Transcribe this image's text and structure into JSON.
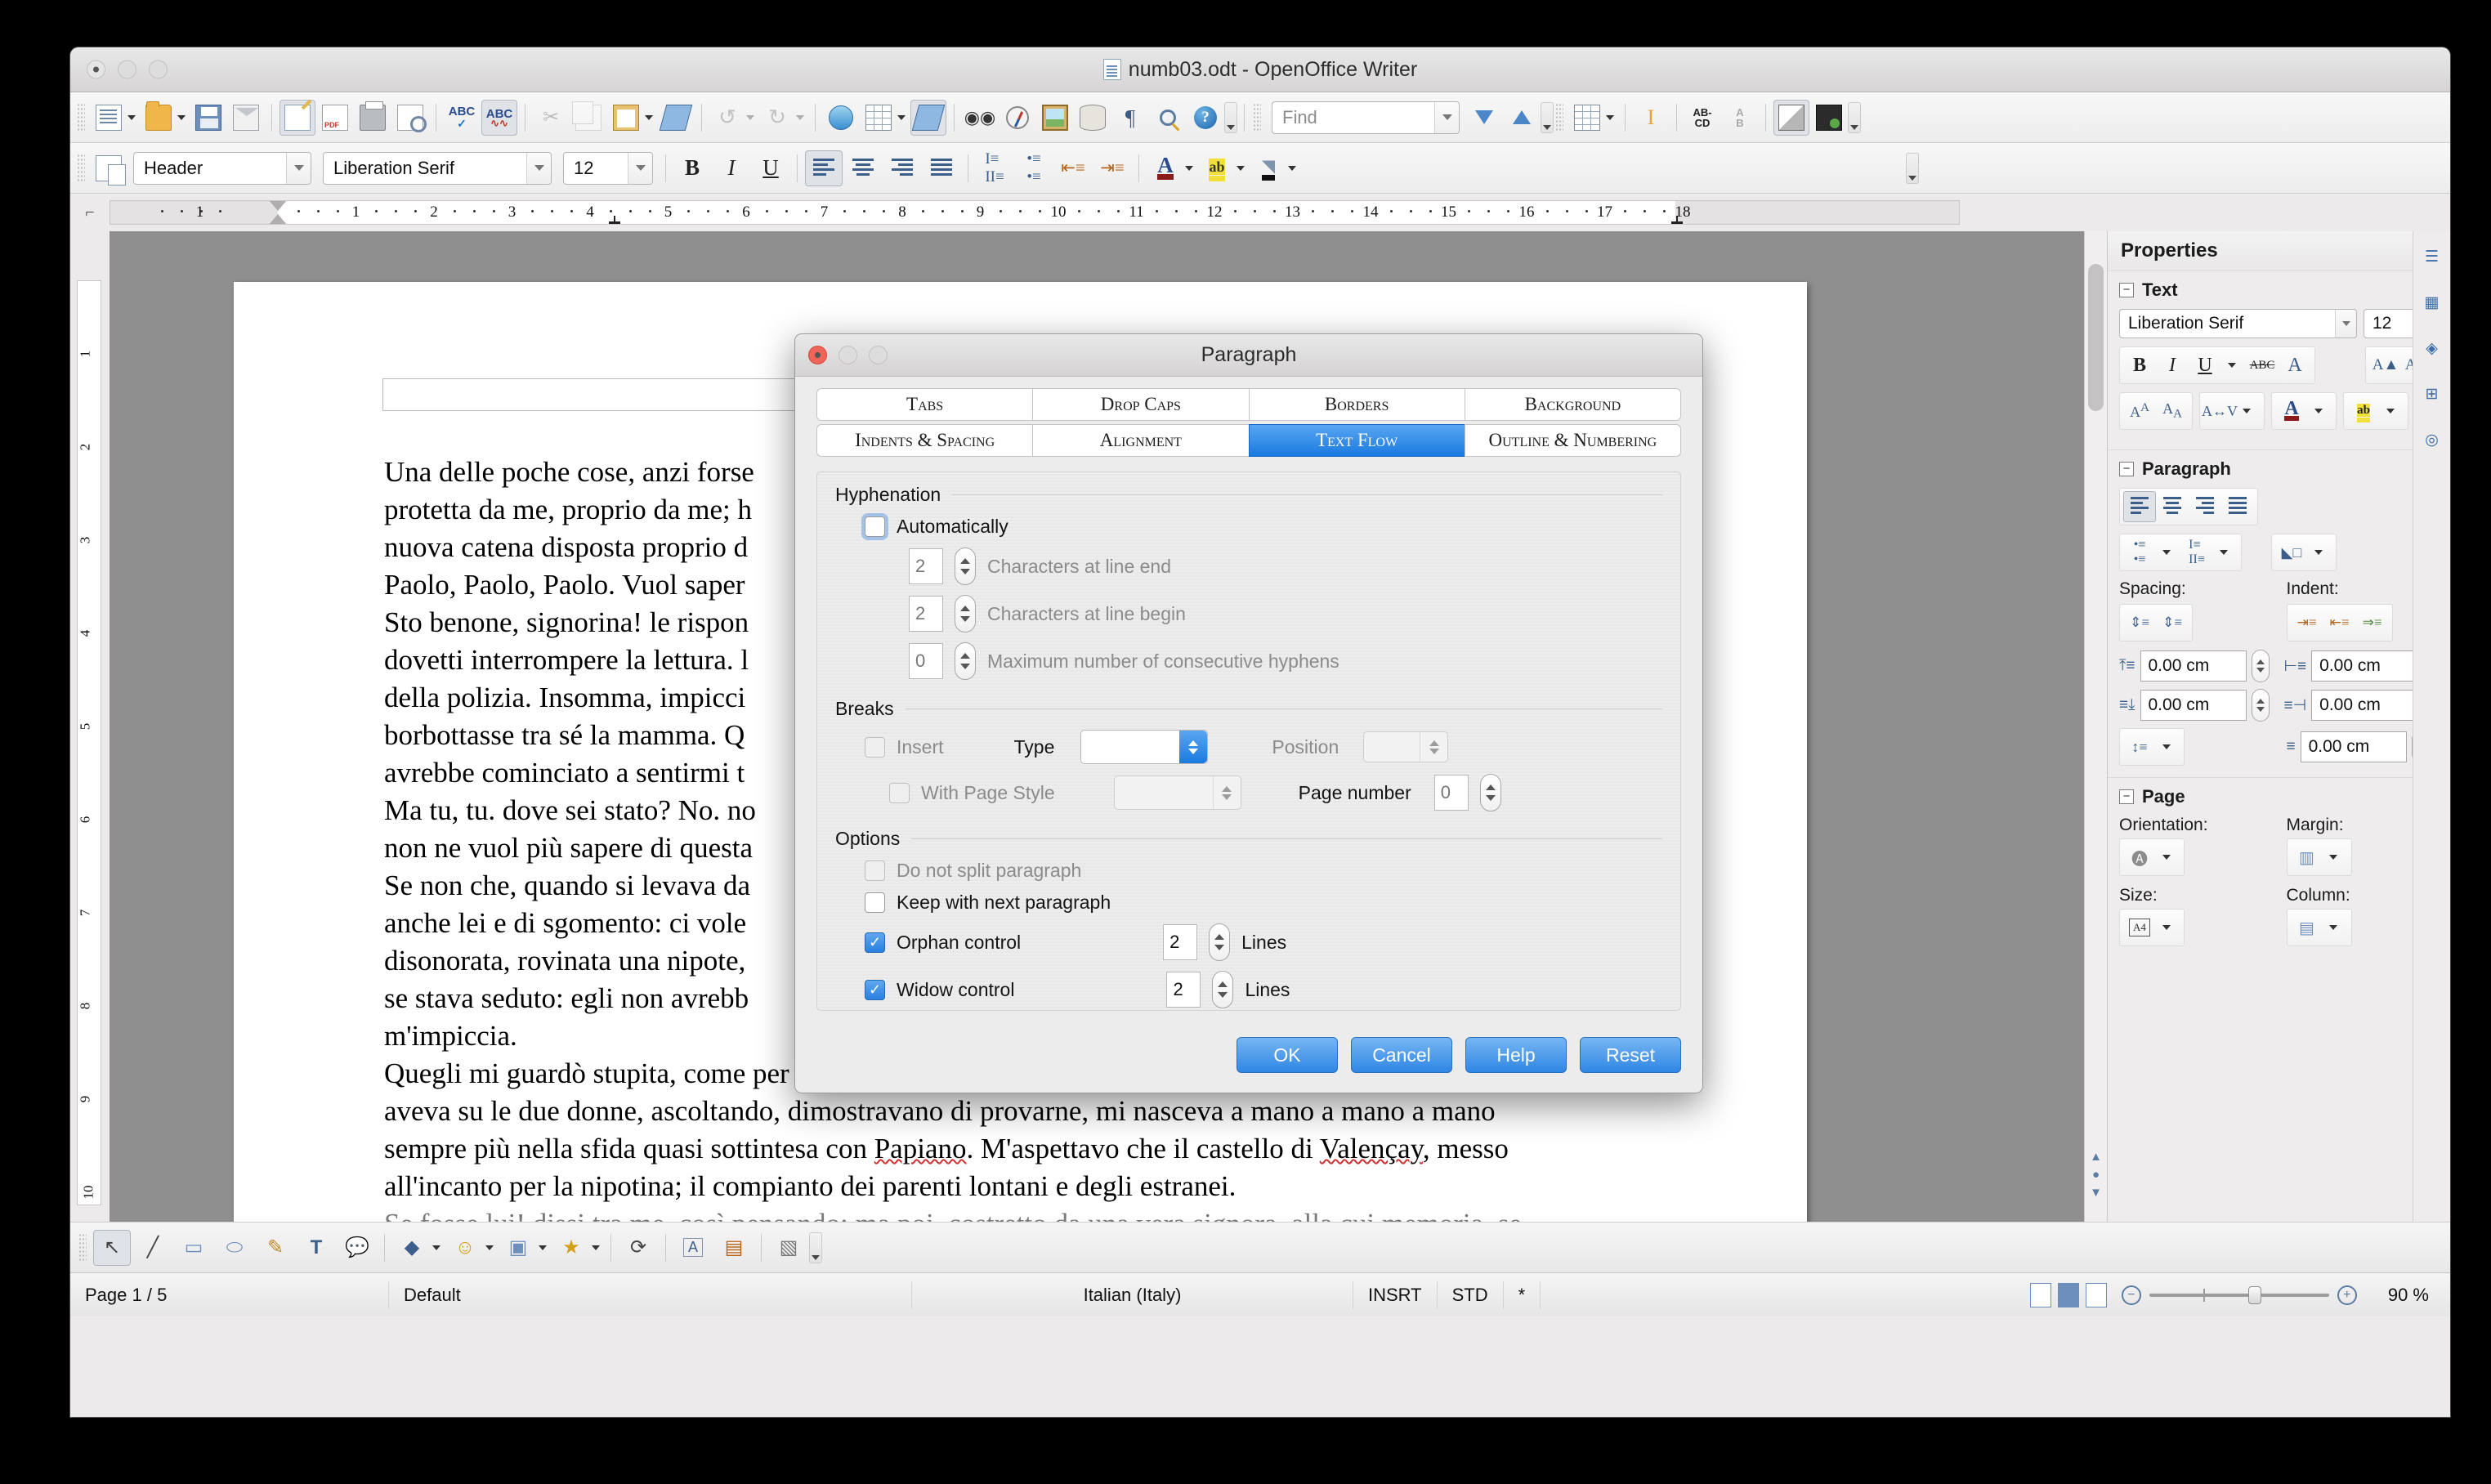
{
  "window": {
    "title": "numb03.odt - OpenOffice Writer"
  },
  "toolbar_standard": [
    {
      "name": "new-document",
      "icon": "new-doc-icon",
      "dropdown": true
    },
    {
      "name": "open-document",
      "icon": "open-folder-icon",
      "dropdown": true
    },
    {
      "name": "save-document",
      "icon": "save-disk-icon"
    },
    {
      "name": "email-document",
      "icon": "email-icon"
    },
    {
      "name": "edit-file",
      "icon": "edit-file-icon",
      "active": true
    },
    {
      "name": "export-pdf",
      "icon": "pdf-icon"
    },
    {
      "name": "print-document",
      "icon": "printer-icon"
    },
    {
      "name": "page-preview",
      "icon": "page-preview-icon"
    },
    {
      "name": "spelling",
      "icon": "spellcheck-icon"
    },
    {
      "name": "autospellcheck",
      "icon": "abc-wave-icon",
      "active": true
    },
    {
      "name": "cut",
      "icon": "scissors-icon",
      "disabled": true
    },
    {
      "name": "copy",
      "icon": "copy-icon",
      "disabled": true
    },
    {
      "name": "paste",
      "icon": "clipboard-icon",
      "dropdown": true
    },
    {
      "name": "clone-formatting",
      "icon": "format-brush-icon"
    },
    {
      "name": "undo",
      "icon": "undo-icon",
      "dropdown": true,
      "disabled": true
    },
    {
      "name": "redo",
      "icon": "redo-icon",
      "dropdown": true,
      "disabled": true
    },
    {
      "name": "hyperlink",
      "icon": "globe-icon"
    },
    {
      "name": "insert-table",
      "icon": "table-icon",
      "dropdown": true
    },
    {
      "name": "show-draw-functions",
      "icon": "draw-pencil-icon",
      "active": true
    },
    {
      "name": "find-replace",
      "icon": "binoculars-icon"
    },
    {
      "name": "navigator",
      "icon": "compass-icon"
    },
    {
      "name": "insert-image",
      "icon": "image-icon"
    },
    {
      "name": "data-sources",
      "icon": "database-icon"
    },
    {
      "name": "formatting-marks",
      "icon": "pilcrow-icon"
    },
    {
      "name": "zoom",
      "icon": "magnifier-icon"
    },
    {
      "name": "help",
      "icon": "help-icon"
    }
  ],
  "find": {
    "placeholder": "Find",
    "value": ""
  },
  "toolbar_find": [
    {
      "name": "find-next",
      "icon": "arrow-down-icon"
    },
    {
      "name": "find-previous",
      "icon": "arrow-up-icon"
    },
    {
      "name": "table-grid",
      "icon": "table-icon",
      "dropdown": true
    },
    {
      "name": "text-cursor",
      "icon": "text-cursor-icon"
    },
    {
      "name": "ab-cd",
      "icon": "abcd-icon"
    },
    {
      "name": "sort",
      "icon": "sort-icon",
      "disabled": true
    },
    {
      "name": "wrap-shadow",
      "icon": "shadow-shape-icon",
      "active": true
    },
    {
      "name": "media",
      "icon": "media-dark-icon"
    }
  ],
  "formatting_bar": {
    "style_icon": "paragraph-style-icon",
    "paragraph_style": "Header",
    "font_name": "Liberation Serif",
    "font_size": "12",
    "buttons": [
      {
        "name": "bold",
        "label": "B"
      },
      {
        "name": "italic",
        "label": "I"
      },
      {
        "name": "underline",
        "label": "U"
      },
      {
        "name": "align-left",
        "label": "align-left-icon",
        "active": true
      },
      {
        "name": "align-center",
        "label": "align-center-icon"
      },
      {
        "name": "align-right",
        "label": "align-right-icon"
      },
      {
        "name": "justify",
        "label": "justify-icon"
      },
      {
        "name": "ordered-list",
        "label": "numbered-list-icon"
      },
      {
        "name": "unordered-list",
        "label": "bullet-list-icon"
      },
      {
        "name": "decrease-indent",
        "label": "decrease-indent-icon"
      },
      {
        "name": "increase-indent",
        "label": "increase-indent-icon"
      },
      {
        "name": "font-color",
        "label": "font-color-icon",
        "dropdown": true
      },
      {
        "name": "highlighting",
        "label": "highlight-icon",
        "dropdown": true
      },
      {
        "name": "background-color",
        "label": "background-color-icon",
        "dropdown": true
      }
    ]
  },
  "ruler": {
    "corner_icon": "tab-stop-icon",
    "left_numbers": [
      "1"
    ],
    "numbers": [
      "1",
      "2",
      "3",
      "4",
      "5",
      "6",
      "7",
      "8",
      "9",
      "10",
      "11",
      "12",
      "13",
      "14",
      "15",
      "16",
      "17",
      "18"
    ],
    "unit": "cm"
  },
  "vertical_ruler": {
    "numbers": [
      "1",
      "2",
      "3",
      "4",
      "5",
      "6",
      "7",
      "8",
      "9",
      "10"
    ]
  },
  "document": {
    "paragraphs": [
      "Una delle poche cose, anzi forse",
      "protetta da me, proprio da me; h",
      "nuova catena disposta proprio d",
      "Paolo, Paolo, Paolo. Vuol saper",
      "Sto benone, signorina! le rispon",
      "dovetti interrompere la lettura. l",
      "della polizia. Insomma, impicci",
      "borbottasse tra sé la mamma. Q",
      "avrebbe cominciato a sentirmi t",
      "Ma tu, tu. dove sei stato? No. no",
      "non ne vuol più sapere di questa",
      "Se non che, quando si levava da",
      "anche lei e di sgomento: ci vole",
      "disonorata, rovinata una nipote,",
      "se stava seduto: egli non avrebb",
      "m'impiccia."
    ],
    "paragraph2_lines": [
      "Quegli mi guardò stupita, come per scuotermela d'addosso, e mi fecero mia cognata allora, che",
      "aveva su le due donne, ascoltando, dimostravano di provarne, mi nasceva a mano a mano a mano",
      "sempre più nella sfida quasi sottintesa con Papiano. M'aspettavo che il castello di Valençay, messo",
      "all'incanto per la nipotina; il compianto dei parenti lontani e degli estranei."
    ],
    "paragraph3_line": "Se fosse lui! dissi tra me, così pensando: ma poi, costretto da una vera signora, alla cui memoria, se"
  },
  "sidebar": {
    "title": "Properties",
    "close_icon": "close-icon",
    "sections": {
      "text": {
        "title": "Text",
        "more_icon": "more-options-icon",
        "font_name": "Liberation Serif",
        "font_size": "12",
        "buttons": [
          {
            "name": "bold",
            "label": "B"
          },
          {
            "name": "italic",
            "label": "I"
          },
          {
            "name": "underline",
            "label": "U",
            "dropdown": true
          },
          {
            "name": "strikethrough",
            "label": "ABC"
          },
          {
            "name": "shadow",
            "label": "A"
          },
          {
            "name": "increase-font-size",
            "label": "grow-font-icon"
          },
          {
            "name": "decrease-font-size",
            "label": "shrink-font-icon"
          },
          {
            "name": "superscript",
            "label": "superscript-icon"
          },
          {
            "name": "subscript",
            "label": "subscript-icon"
          },
          {
            "name": "character-spacing",
            "label": "spacing-icon",
            "dropdown": true
          },
          {
            "name": "font-color",
            "label": "font-color-icon",
            "dropdown": true
          },
          {
            "name": "highlighting",
            "label": "highlight-icon",
            "dropdown": true
          }
        ]
      },
      "paragraph": {
        "title": "Paragraph",
        "more_icon": "more-options-icon",
        "spacing_label": "Spacing:",
        "indent_label": "Indent:",
        "spacing_above": "0.00 cm",
        "spacing_below": "0.00 cm",
        "indent_before": "0.00 cm",
        "indent_after": "0.00 cm",
        "indent_first_line": "0.00 cm"
      },
      "page": {
        "title": "Page",
        "more_icon": "more-options-icon",
        "orientation_label": "Orientation:",
        "margin_label": "Margin:",
        "size_label": "Size:",
        "column_label": "Column:",
        "size_value": "A4"
      }
    },
    "tabstrip": [
      {
        "name": "properties-tab",
        "icon": "properties-icon"
      },
      {
        "name": "styles-tab",
        "icon": "styles-icon"
      },
      {
        "name": "gallery-tab",
        "icon": "gallery-icon"
      },
      {
        "name": "navigator-tab",
        "icon": "navigator-icon"
      },
      {
        "name": "shapes-tab",
        "icon": "shapes-icon"
      }
    ]
  },
  "drawbar": [
    {
      "name": "select",
      "icon": "arrow-select-icon",
      "active": true
    },
    {
      "name": "line",
      "icon": "line-icon"
    },
    {
      "name": "rectangle",
      "icon": "rectangle-icon"
    },
    {
      "name": "ellipse",
      "icon": "ellipse-icon"
    },
    {
      "name": "freeform-line",
      "icon": "freeform-icon"
    },
    {
      "name": "text-box",
      "icon": "text-box-icon"
    },
    {
      "name": "callouts",
      "icon": "callout-icon"
    },
    {
      "name": "basic-shapes",
      "icon": "basic-shapes-icon",
      "dropdown": true
    },
    {
      "name": "symbol-shapes",
      "icon": "symbol-shapes-icon",
      "dropdown": true
    },
    {
      "name": "block-arrows",
      "icon": "block-arrows-icon",
      "dropdown": true
    },
    {
      "name": "stars",
      "icon": "stars-icon",
      "dropdown": true
    },
    {
      "name": "rotate",
      "icon": "rotate-icon"
    },
    {
      "name": "fontwork",
      "icon": "fontwork-icon"
    },
    {
      "name": "from-file",
      "icon": "image-from-file-icon"
    },
    {
      "name": "extrusion",
      "icon": "extrusion-icon"
    }
  ],
  "statusbar": {
    "page": "Page 1 / 5",
    "style": "Default",
    "language": "Italian (Italy)",
    "insert_mode": "INSRT",
    "selection_mode": "STD",
    "modified": "*",
    "zoom": "90 %",
    "view_layouts": [
      "single-page-icon",
      "multi-page-icon",
      "book-view-icon"
    ]
  },
  "dialog": {
    "title": "Paragraph",
    "tabs_row1": [
      {
        "label": "Tabs",
        "selected": false
      },
      {
        "label": "Drop Caps",
        "selected": false
      },
      {
        "label": "Borders",
        "selected": false
      },
      {
        "label": "Background",
        "selected": false
      }
    ],
    "tabs_row2": [
      {
        "label": "Indents & Spacing",
        "selected": false
      },
      {
        "label": "Alignment",
        "selected": false
      },
      {
        "label": "Text Flow",
        "selected": true
      },
      {
        "label": "Outline & Numbering",
        "selected": false
      }
    ],
    "hyphenation": {
      "group_label": "Hyphenation",
      "automatically": {
        "label": "Automatically",
        "checked": false
      },
      "chars_line_end": {
        "label": "Characters at line end",
        "value": "2",
        "disabled": true
      },
      "chars_line_begin": {
        "label": "Characters at line begin",
        "value": "2",
        "disabled": true
      },
      "max_hyphens": {
        "label": "Maximum number of consecutive hyphens",
        "value": "0",
        "disabled": true
      }
    },
    "breaks": {
      "group_label": "Breaks",
      "insert": {
        "label": "Insert",
        "checked": false,
        "disabled": true
      },
      "type_label": "Type",
      "type_value": "",
      "position_label": "Position",
      "position_value": "",
      "with_page_style": {
        "label": "With Page Style",
        "checked": false,
        "disabled": true
      },
      "page_style_value": "",
      "page_number_label": "Page number",
      "page_number_value": "0"
    },
    "options": {
      "group_label": "Options",
      "do_not_split": {
        "label": "Do not split paragraph",
        "checked": false,
        "disabled": true
      },
      "keep_with_next": {
        "label": "Keep with next paragraph",
        "checked": false
      },
      "orphan_control": {
        "label": "Orphan control",
        "checked": true,
        "value": "2",
        "unit": "Lines"
      },
      "widow_control": {
        "label": "Widow control",
        "checked": true,
        "value": "2",
        "unit": "Lines"
      }
    },
    "buttons": [
      {
        "label": "OK",
        "name": "ok-button"
      },
      {
        "label": "Cancel",
        "name": "cancel-button"
      },
      {
        "label": "Help",
        "name": "help-button"
      },
      {
        "label": "Reset",
        "name": "reset-button"
      }
    ]
  },
  "colors": {
    "accent_blue": "#1a7ae0",
    "tab_selected": "#2f86e4",
    "window_bg": "#ececec",
    "canvas_bg": "#8f8f8f"
  }
}
